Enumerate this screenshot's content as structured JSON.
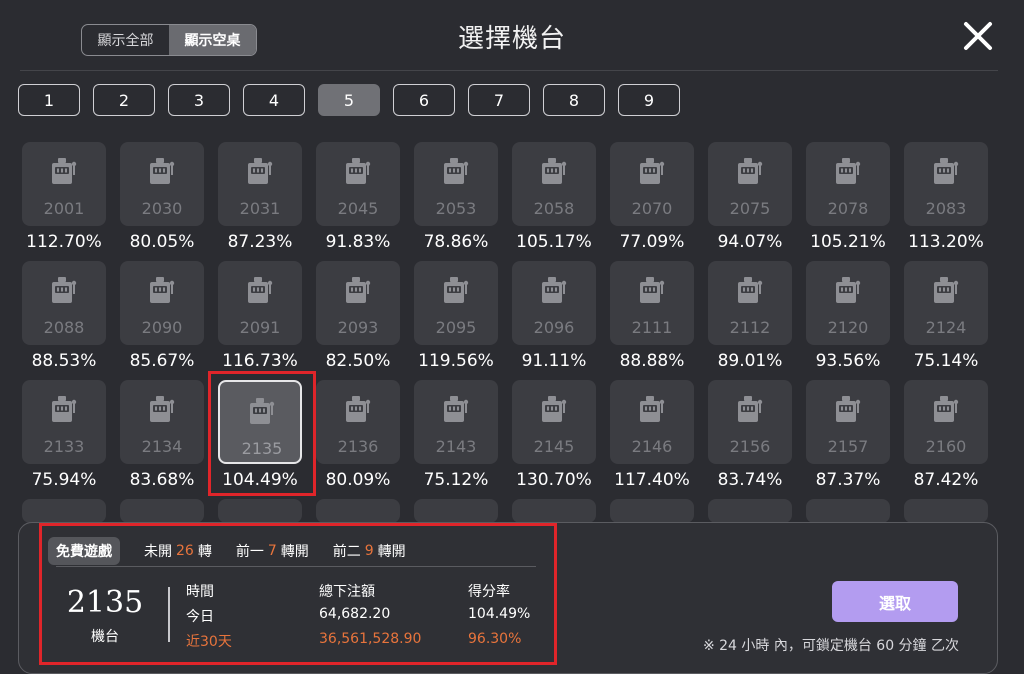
{
  "header": {
    "title": "選擇機台",
    "toggle": [
      "顯示全部",
      "顯示空桌"
    ],
    "toggle_active": 1
  },
  "pages": [
    "1",
    "2",
    "3",
    "4",
    "5",
    "6",
    "7",
    "8",
    "9"
  ],
  "active_page": "5",
  "machines": [
    [
      "2001",
      "112.70%"
    ],
    [
      "2030",
      "80.05%"
    ],
    [
      "2031",
      "87.23%"
    ],
    [
      "2045",
      "91.83%"
    ],
    [
      "2053",
      "78.86%"
    ],
    [
      "2058",
      "105.17%"
    ],
    [
      "2070",
      "77.09%"
    ],
    [
      "2075",
      "94.07%"
    ],
    [
      "2078",
      "105.21%"
    ],
    [
      "2083",
      "113.20%"
    ],
    [
      "2088",
      "88.53%"
    ],
    [
      "2090",
      "85.67%"
    ],
    [
      "2091",
      "116.73%"
    ],
    [
      "2093",
      "82.50%"
    ],
    [
      "2095",
      "119.56%"
    ],
    [
      "2096",
      "91.11%"
    ],
    [
      "2111",
      "88.88%"
    ],
    [
      "2112",
      "89.01%"
    ],
    [
      "2120",
      "93.56%"
    ],
    [
      "2124",
      "75.14%"
    ],
    [
      "2133",
      "75.94%"
    ],
    [
      "2134",
      "83.68%"
    ],
    [
      "2135",
      "104.49%"
    ],
    [
      "2136",
      "80.09%"
    ],
    [
      "2143",
      "75.12%"
    ],
    [
      "2145",
      "130.70%"
    ],
    [
      "2146",
      "117.40%"
    ],
    [
      "2156",
      "83.74%"
    ],
    [
      "2157",
      "87.37%"
    ],
    [
      "2160",
      "87.42%"
    ]
  ],
  "selected_machine": "2135",
  "info": {
    "tabs": [
      {
        "label": "免費遊戲",
        "active": true
      },
      {
        "pre": "未開",
        "value": "26",
        "post": "轉"
      },
      {
        "pre": "前一",
        "value": "7",
        "post": "轉開"
      },
      {
        "pre": "前二",
        "value": "9",
        "post": "轉開"
      }
    ],
    "machine_id": "2135",
    "machine_label": "機台",
    "headers": [
      "時間",
      "總下注額",
      "得分率"
    ],
    "today": [
      "今日",
      "64,682.20",
      "104.49%"
    ],
    "last30": [
      "近30天",
      "36,561,528.90",
      "96.30%"
    ],
    "select_label": "選取",
    "note": "※ 24 小時 內，可鎖定機台 60 分鐘 乙次"
  },
  "colors": {
    "background": "#2b2c31",
    "tile": "#3c3d42",
    "accent_orange": "#e8743c",
    "select_button": "#b39cf0",
    "highlight_red": "#e0252a"
  }
}
